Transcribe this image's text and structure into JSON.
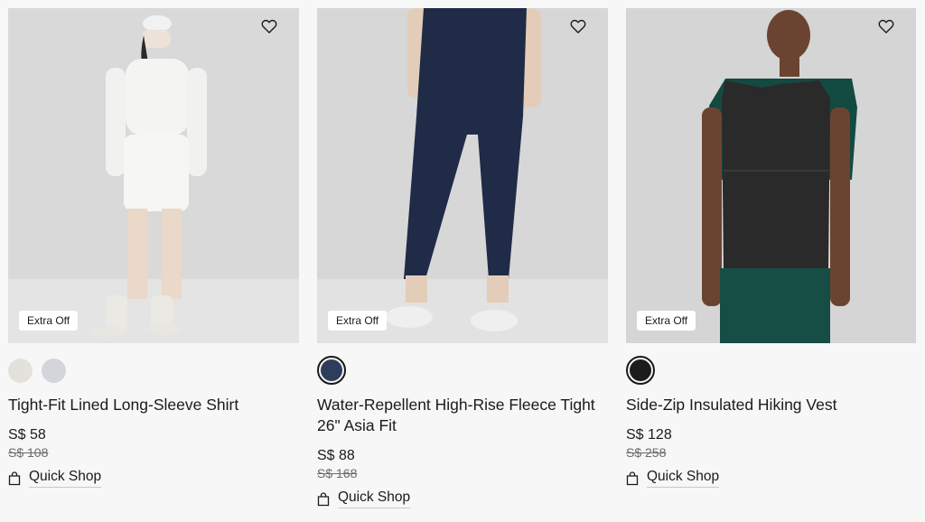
{
  "products": [
    {
      "name": "Tight-Fit Lined Long-Sleeve Shirt",
      "badge": "Extra Off",
      "price": "S$ 58",
      "was_price": "S$ 108",
      "quick_shop": "Quick Shop",
      "wishlist_icon": "heart-icon",
      "swatches": [
        {
          "color": "#e3e1db",
          "selected": false
        },
        {
          "color": "#d4d5dc",
          "selected": false
        }
      ]
    },
    {
      "name": "Water-Repellent High-Rise Fleece Tight 26\" Asia Fit",
      "badge": "Extra Off",
      "price": "S$ 88",
      "was_price": "S$ 168",
      "quick_shop": "Quick Shop",
      "wishlist_icon": "heart-icon",
      "swatches": [
        {
          "color": "#2e3d5c",
          "selected": true
        }
      ]
    },
    {
      "name": "Side-Zip Insulated Hiking Vest",
      "badge": "Extra Off",
      "price": "S$ 128",
      "was_price": "S$ 258",
      "quick_shop": "Quick Shop",
      "wishlist_icon": "heart-icon",
      "swatches": [
        {
          "color": "#1c1c1c",
          "selected": true
        }
      ]
    }
  ],
  "colors": {
    "background": "#f7f7f7",
    "photo_bg": "#dcdcdc",
    "text": "#1a1a1a",
    "muted": "#6b6b6b"
  }
}
